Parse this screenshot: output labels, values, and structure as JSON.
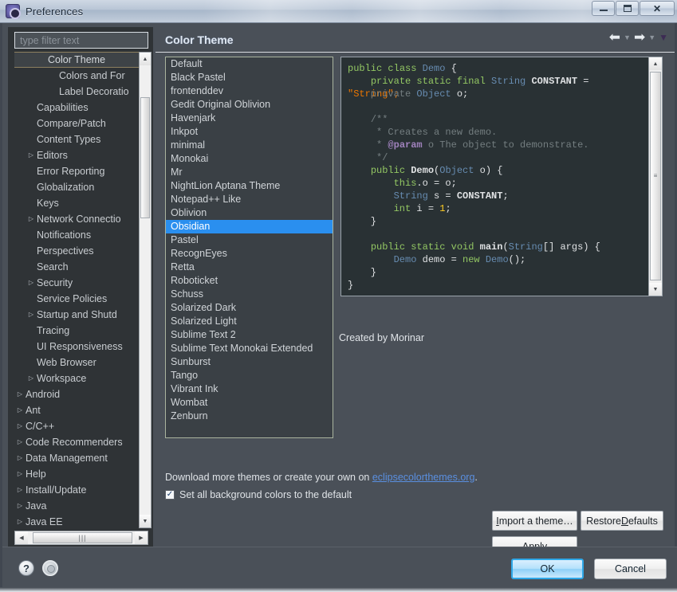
{
  "window": {
    "title": "Preferences",
    "icon": "preferences-gear-icon",
    "minimize_label": "Minimize",
    "maximize_label": "Maximize",
    "close_label": "Close"
  },
  "sidebar": {
    "filter": {
      "value": "",
      "placeholder": "type filter text"
    },
    "items": [
      {
        "label": "Color Theme",
        "indent": 3,
        "arrow": "",
        "selected": true
      },
      {
        "label": "Colors and For",
        "indent": 4,
        "arrow": "",
        "selected": false
      },
      {
        "label": "Label Decoratio",
        "indent": 4,
        "arrow": "",
        "selected": false
      },
      {
        "label": "Capabilities",
        "indent": 2,
        "arrow": "",
        "selected": false
      },
      {
        "label": "Compare/Patch",
        "indent": 2,
        "arrow": "",
        "selected": false
      },
      {
        "label": "Content Types",
        "indent": 2,
        "arrow": "",
        "selected": false
      },
      {
        "label": "Editors",
        "indent": 2,
        "arrow": "▷",
        "selected": false
      },
      {
        "label": "Error Reporting",
        "indent": 2,
        "arrow": "",
        "selected": false
      },
      {
        "label": "Globalization",
        "indent": 2,
        "arrow": "",
        "selected": false
      },
      {
        "label": "Keys",
        "indent": 2,
        "arrow": "",
        "selected": false
      },
      {
        "label": "Network Connectio",
        "indent": 2,
        "arrow": "▷",
        "selected": false
      },
      {
        "label": "Notifications",
        "indent": 2,
        "arrow": "",
        "selected": false
      },
      {
        "label": "Perspectives",
        "indent": 2,
        "arrow": "",
        "selected": false
      },
      {
        "label": "Search",
        "indent": 2,
        "arrow": "",
        "selected": false
      },
      {
        "label": "Security",
        "indent": 2,
        "arrow": "▷",
        "selected": false
      },
      {
        "label": "Service Policies",
        "indent": 2,
        "arrow": "",
        "selected": false
      },
      {
        "label": "Startup and Shutd",
        "indent": 2,
        "arrow": "▷",
        "selected": false
      },
      {
        "label": "Tracing",
        "indent": 2,
        "arrow": "",
        "selected": false
      },
      {
        "label": "UI Responsiveness",
        "indent": 2,
        "arrow": "",
        "selected": false
      },
      {
        "label": "Web Browser",
        "indent": 2,
        "arrow": "",
        "selected": false
      },
      {
        "label": "Workspace",
        "indent": 2,
        "arrow": "▷",
        "selected": false
      },
      {
        "label": "Android",
        "indent": 1,
        "arrow": "▷",
        "selected": false
      },
      {
        "label": "Ant",
        "indent": 1,
        "arrow": "▷",
        "selected": false
      },
      {
        "label": "C/C++",
        "indent": 1,
        "arrow": "▷",
        "selected": false
      },
      {
        "label": "Code Recommenders",
        "indent": 1,
        "arrow": "▷",
        "selected": false
      },
      {
        "label": "Data Management",
        "indent": 1,
        "arrow": "▷",
        "selected": false
      },
      {
        "label": "Help",
        "indent": 1,
        "arrow": "▷",
        "selected": false
      },
      {
        "label": "Install/Update",
        "indent": 1,
        "arrow": "▷",
        "selected": false
      },
      {
        "label": "Java",
        "indent": 1,
        "arrow": "▷",
        "selected": false
      },
      {
        "label": "Java EE",
        "indent": 1,
        "arrow": "▷",
        "selected": false
      }
    ]
  },
  "page": {
    "title": "Color Theme",
    "nav": {
      "back_icon": "arrow-left-icon",
      "back_menu_icon": "chevron-down-icon",
      "forward_icon": "arrow-right-icon",
      "forward_menu_icon": "chevron-down-icon",
      "overflow_icon": "chevron-down-icon"
    }
  },
  "theme_list": {
    "selected": "Obsidian",
    "items": [
      "Default",
      "Black Pastel",
      "frontenddev",
      "Gedit Original Oblivion",
      "Havenjark",
      "Inkpot",
      "minimal",
      "Monokai",
      "Mr",
      "NightLion Aptana Theme",
      "Notepad++ Like",
      "Oblivion",
      "Obsidian",
      "Pastel",
      "RecognEyes",
      "Retta",
      "Roboticket",
      "Schuss",
      "Solarized Dark",
      "Solarized Light",
      "Sublime Text 2",
      "Sublime Text Monokai Extended",
      "Sunburst",
      "Tango",
      "Vibrant Ink",
      "Wombat",
      "Zenburn"
    ]
  },
  "preview": {
    "code_lines": [
      [
        {
          "t": "public ",
          "c": "kw"
        },
        {
          "t": "class ",
          "c": "kw"
        },
        {
          "t": "Demo",
          "c": "cls"
        },
        {
          "t": " {",
          "c": "pln"
        }
      ],
      [
        {
          "t": "    ",
          "c": "pln"
        },
        {
          "t": "private static final ",
          "c": "kw"
        },
        {
          "t": "String ",
          "c": "typ"
        },
        {
          "t": "CONSTANT",
          "c": "cst"
        },
        {
          "t": " =",
          "c": "pln"
        }
      ],
      [
        {
          "t": "\"String\";",
          "c": "str"
        }
      ],
      [
        {
          "t": "",
          "c": "pln"
        }
      ],
      [
        {
          "t": "    ",
          "c": "pln"
        },
        {
          "t": "/**",
          "c": "doc"
        }
      ],
      [
        {
          "t": "     * Creates a new demo.",
          "c": "doc"
        }
      ],
      [
        {
          "t": "     * ",
          "c": "doc"
        },
        {
          "t": "@param",
          "c": "tag"
        },
        {
          "t": " o The object to demonstrate.",
          "c": "doc"
        }
      ],
      [
        {
          "t": "     */",
          "c": "doc"
        }
      ],
      [
        {
          "t": "    ",
          "c": "pln"
        },
        {
          "t": "public ",
          "c": "kw"
        },
        {
          "t": "Demo",
          "c": "fn"
        },
        {
          "t": "(",
          "c": "pln"
        },
        {
          "t": "Object",
          "c": "typ"
        },
        {
          "t": " o) {",
          "c": "pln"
        }
      ],
      [
        {
          "t": "        ",
          "c": "pln"
        },
        {
          "t": "this",
          "c": "kw"
        },
        {
          "t": ".o = o;",
          "c": "pln"
        }
      ],
      [
        {
          "t": "        ",
          "c": "pln"
        },
        {
          "t": "String",
          "c": "typ"
        },
        {
          "t": " s = ",
          "c": "pln"
        },
        {
          "t": "CONSTANT",
          "c": "cst"
        },
        {
          "t": ";",
          "c": "pln"
        }
      ],
      [
        {
          "t": "        ",
          "c": "pln"
        },
        {
          "t": "int",
          "c": "kw"
        },
        {
          "t": " i = ",
          "c": "pln"
        },
        {
          "t": "1",
          "c": "num"
        },
        {
          "t": ";",
          "c": "pln"
        }
      ],
      [
        {
          "t": "    }",
          "c": "pln"
        }
      ],
      [
        {
          "t": "",
          "c": "pln"
        }
      ],
      [
        {
          "t": "    ",
          "c": "pln"
        },
        {
          "t": "public static void ",
          "c": "kw"
        },
        {
          "t": "main",
          "c": "fn"
        },
        {
          "t": "(",
          "c": "pln"
        },
        {
          "t": "String",
          "c": "typ"
        },
        {
          "t": "[] args) {",
          "c": "pln"
        }
      ],
      [
        {
          "t": "        ",
          "c": "pln"
        },
        {
          "t": "Demo",
          "c": "cls"
        },
        {
          "t": " demo = ",
          "c": "pln"
        },
        {
          "t": "new ",
          "c": "kw"
        },
        {
          "t": "Demo",
          "c": "cls"
        },
        {
          "t": "();",
          "c": "pln"
        }
      ],
      [
        {
          "t": "    }",
          "c": "pln"
        }
      ],
      [
        {
          "t": "}",
          "c": "pln"
        }
      ]
    ],
    "overlap_line": [
      {
        "t": "    private ",
        "c": "cmt"
      },
      {
        "t": "Object",
        "c": "typ"
      },
      {
        "t": " o;",
        "c": "pln"
      }
    ]
  },
  "author": "Created by Morinar",
  "download": {
    "prefix": "Download more themes or create your own on ",
    "link": "eclipsecolorthemes.org",
    "suffix": "."
  },
  "checkbox": {
    "label": "Set all background colors to the default",
    "checked": true,
    "mark": "✓"
  },
  "buttons": {
    "import": {
      "mnemonic": "I",
      "rest": "mport a theme…"
    },
    "restore": {
      "pre": "Restore ",
      "mnemonic": "D",
      "rest": "efaults"
    },
    "apply": {
      "mnemonic": "A",
      "rest": "pply"
    },
    "ok": "OK",
    "cancel": "Cancel"
  },
  "footer_icons": {
    "help": "help-question-icon",
    "help_glyph": "?",
    "settings": "settings-circle-icon"
  },
  "colors": {
    "selection_blue": "#2a8fef",
    "dialog_bg": "#4a5058",
    "tree_bg": "#2f3336",
    "code_bg": "#293134",
    "link": "#5a8fe0"
  }
}
